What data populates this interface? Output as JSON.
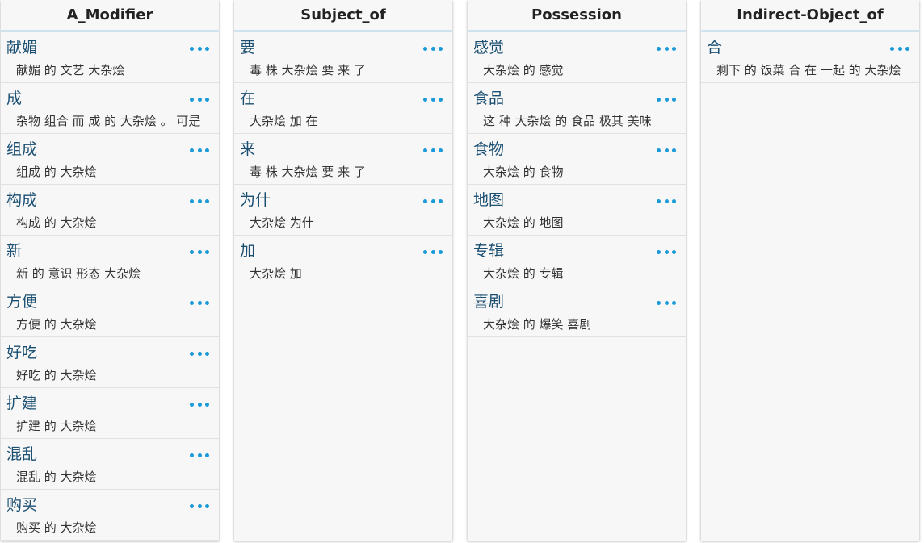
{
  "colors": {
    "word": "#1b4f72",
    "dots": "#1a9ad8",
    "header_rule": "#cfe3ee"
  },
  "columns": [
    {
      "title": "A_Modifier",
      "rows": [
        {
          "word": "献媚",
          "example": "献媚 的 文艺 大杂烩"
        },
        {
          "word": "成",
          "example": "杂物 组合 而 成 的 大杂烩 。 可是"
        },
        {
          "word": "组成",
          "example": "组成 的 大杂烩"
        },
        {
          "word": "构成",
          "example": "构成 的 大杂烩"
        },
        {
          "word": "新",
          "example": "新 的 意识 形态 大杂烩"
        },
        {
          "word": "方便",
          "example": "方便 的 大杂烩"
        },
        {
          "word": "好吃",
          "example": "好吃 的 大杂烩"
        },
        {
          "word": "扩建",
          "example": "扩建 的 大杂烩"
        },
        {
          "word": "混乱",
          "example": "混乱 的 大杂烩"
        },
        {
          "word": "购买",
          "example": "购买 的 大杂烩"
        }
      ]
    },
    {
      "title": "Subject_of",
      "rows": [
        {
          "word": "要",
          "example": "毒 株 大杂烩 要 来 了"
        },
        {
          "word": "在",
          "example": "大杂烩 加 在"
        },
        {
          "word": "来",
          "example": "毒 株 大杂烩 要 来 了"
        },
        {
          "word": "为什",
          "example": "大杂烩 为什"
        },
        {
          "word": "加",
          "example": "大杂烩 加"
        }
      ]
    },
    {
      "title": "Possession",
      "rows": [
        {
          "word": "感觉",
          "example": "大杂烩 的 感觉"
        },
        {
          "word": "食品",
          "example": "这 种 大杂烩 的 食品 极其 美味"
        },
        {
          "word": "食物",
          "example": "大杂烩 的 食物"
        },
        {
          "word": "地图",
          "example": "大杂烩 的 地图"
        },
        {
          "word": "专辑",
          "example": "大杂烩 的 专辑"
        },
        {
          "word": "喜剧",
          "example": "大杂烩 的 爆笑 喜剧"
        }
      ]
    },
    {
      "title": "Indirect-Object_of",
      "rows": [
        {
          "word": "合",
          "example": "剩下 的 饭菜 合 在 一起 的 大杂烩"
        }
      ]
    }
  ]
}
